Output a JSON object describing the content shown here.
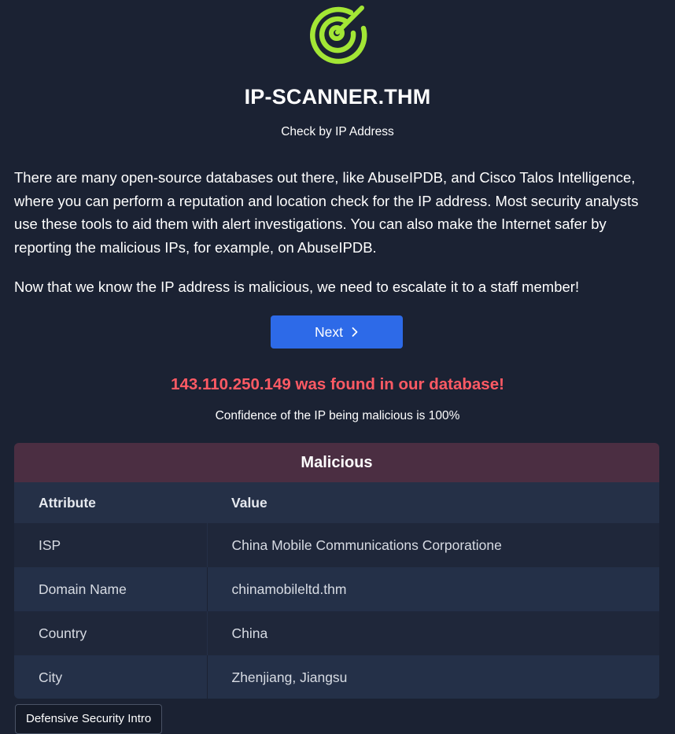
{
  "app": {
    "title": "IP-SCANNER.THM",
    "subtitle": "Check by IP Address",
    "logo_icon": "target-radar-icon",
    "accent_color": "#a3e635"
  },
  "content": {
    "paragraph1": "There are many open-source databases out there, like AbuseIPDB, and Cisco Talos Intelligence, where you can perform a reputation and location check for the IP address. Most security analysts use these tools to aid them with alert investigations. You can also make the Internet safer by reporting the malicious IPs, for example, on AbuseIPDB.",
    "paragraph2": "Now that we know the IP address is malicious, we need to escalate it to a staff member!"
  },
  "next_button": {
    "label": "Next",
    "icon": "chevron-right-icon",
    "color": "#2d6ae8"
  },
  "result": {
    "alert": "143.110.250.149 was found in our database!",
    "alert_color": "#ff5a64",
    "confidence": "Confidence of the IP being malicious is 100%"
  },
  "table": {
    "title": "Malicious",
    "header_color": "#4b2e42",
    "columns": [
      "Attribute",
      "Value"
    ],
    "rows": [
      {
        "attribute": "ISP",
        "value": "China Mobile Communications Corporatione"
      },
      {
        "attribute": "Domain Name",
        "value": "chinamobileltd.thm"
      },
      {
        "attribute": "Country",
        "value": "China"
      },
      {
        "attribute": "City",
        "value": "Zhenjiang, Jiangsu"
      }
    ]
  },
  "footer": {
    "tab_label": "Defensive Security Intro"
  }
}
